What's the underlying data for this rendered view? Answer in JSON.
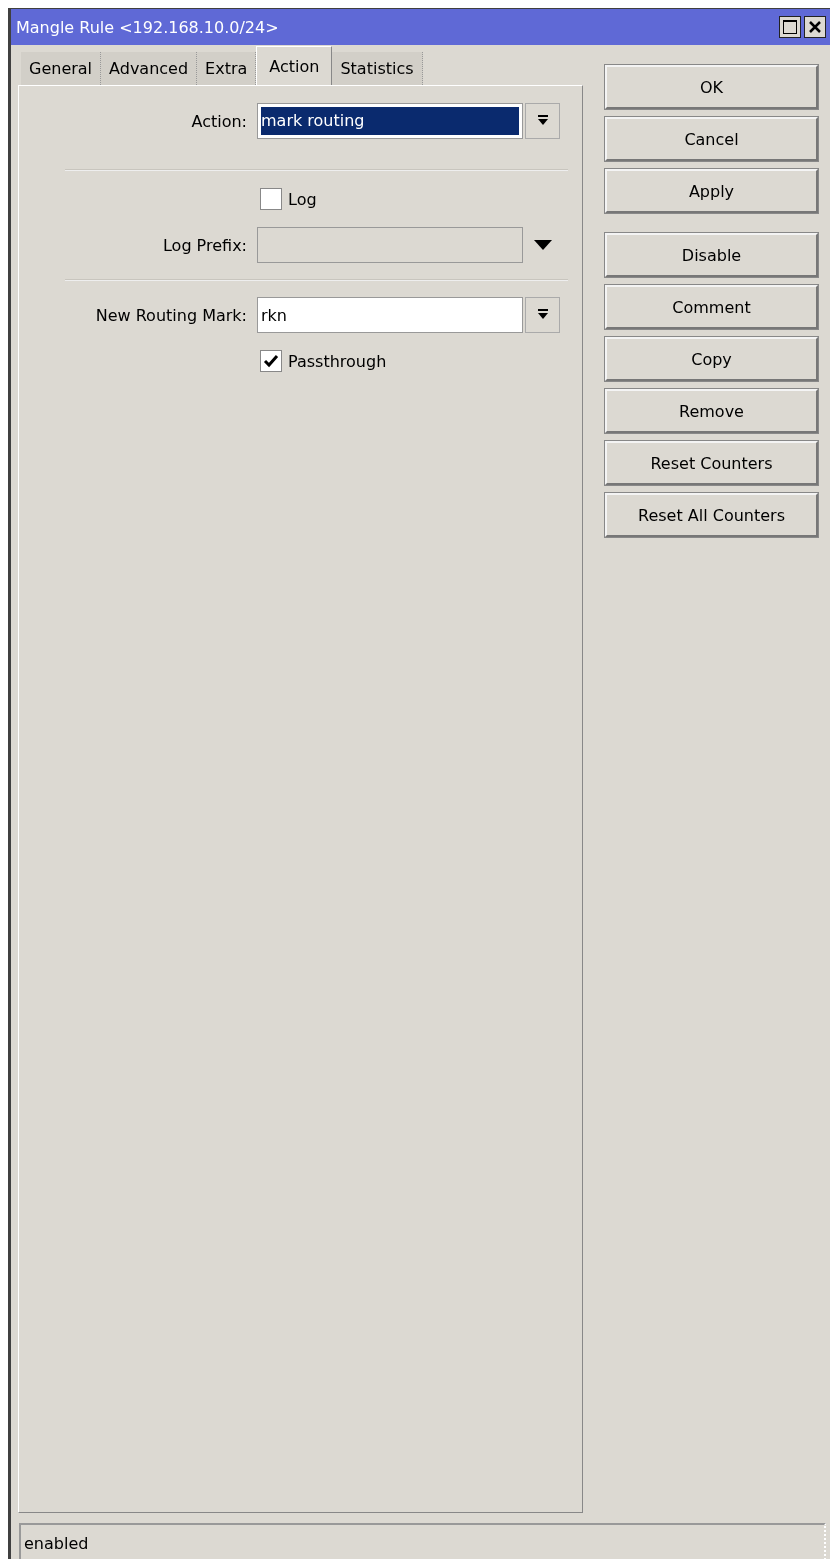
{
  "window": {
    "title": "Mangle Rule <192.168.10.0/24>"
  },
  "tabs": [
    {
      "label": "General",
      "selected": false
    },
    {
      "label": "Advanced",
      "selected": false
    },
    {
      "label": "Extra",
      "selected": false
    },
    {
      "label": "Action",
      "selected": true
    },
    {
      "label": "Statistics",
      "selected": false
    }
  ],
  "form": [
    {
      "kind": "select",
      "label": "Action:",
      "value": "mark routing",
      "highlighted": true
    },
    {
      "kind": "divider"
    },
    {
      "kind": "checkbox",
      "label": "Log",
      "checked": false
    },
    {
      "kind": "text",
      "label": "Log Prefix:",
      "disabled": true
    },
    {
      "kind": "divider"
    },
    {
      "kind": "select",
      "label": "New Routing Mark:",
      "value": "rkn",
      "highlighted": false
    },
    {
      "kind": "checkbox",
      "label": "Passthrough",
      "checked": true
    }
  ],
  "button_groups": [
    [
      "OK",
      "Cancel",
      "Apply"
    ],
    [
      "Disable",
      "Comment",
      "Copy",
      "Remove",
      "Reset Counters",
      "Reset All Counters"
    ]
  ],
  "status_bar": "enabled"
}
